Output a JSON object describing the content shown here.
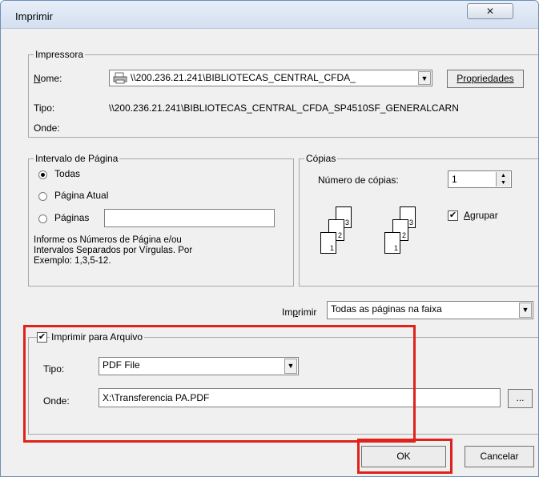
{
  "window": {
    "title": "Imprimir",
    "close_glyph": "✕"
  },
  "printer": {
    "group_label": "Impressora",
    "name_label": "Nome:",
    "name_value": "\\\\200.236.21.241\\BIBLIOTECAS_CENTRAL_CFDA_",
    "properties_label": "Propriedades",
    "type_label": "Tipo:",
    "type_value": "\\\\200.236.21.241\\BIBLIOTECAS_CENTRAL_CFDA_SP4510SF_GENERALCARN",
    "where_label": "Onde:"
  },
  "range": {
    "group_label": "Intervalo de Página",
    "all_label": "Todas",
    "current_label": "Página Atual",
    "pages_label": "Páginas",
    "pages_value": "",
    "hint": [
      "Informe os Números de Página e/ou",
      "Intervalos Separados por Vírgulas. Por",
      "Exemplo: 1,3,5-12."
    ]
  },
  "copies": {
    "group_label": "Cópias",
    "count_label": "Número de cópias:",
    "count_value": "1",
    "collate_label": "Agrupar",
    "collate_checked": true,
    "page_numbers": [
      "3",
      "2",
      "1"
    ]
  },
  "print_what": {
    "label": "Imprimir",
    "value": "Todas as páginas na faixa"
  },
  "print_to_file": {
    "label": "Imprimir para Arquivo",
    "checked": true,
    "type_label": "Tipo:",
    "type_value": "PDF File",
    "where_label": "Onde:",
    "where_value": "X:\\Transferencia PA.PDF",
    "browse_label": "..."
  },
  "buttons": {
    "ok": "OK",
    "cancel": "Cancelar"
  },
  "colors": {
    "highlight": "#e0221c",
    "title_bar": "#dce6f4"
  },
  "icons": {
    "printer": "printer-icon",
    "dropdown": "chevron-down-icon",
    "spinner": "spinner-arrows-icon"
  }
}
